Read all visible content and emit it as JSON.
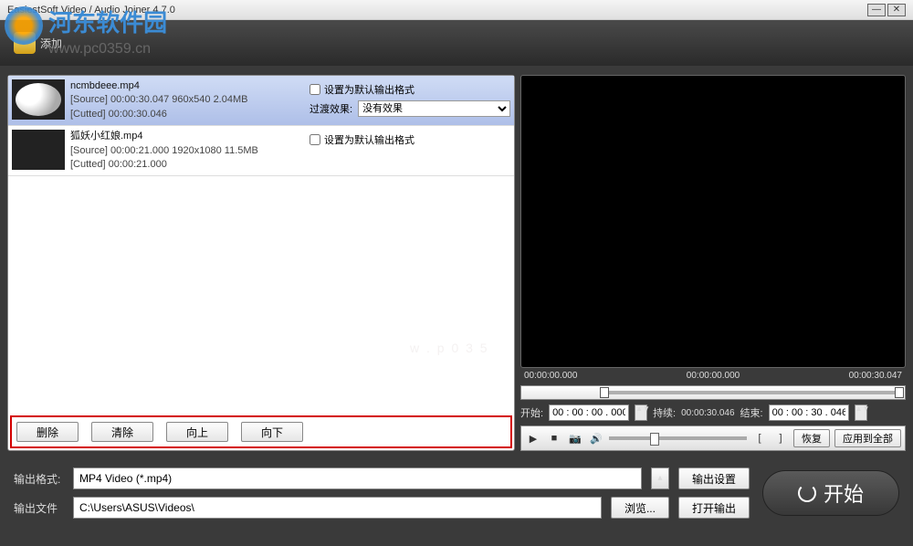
{
  "window": {
    "title": "EasiestSoft Video / Audio Joiner 4.7.0"
  },
  "watermark": {
    "text": "河东软件园",
    "url": "www.pc0359.cn"
  },
  "toolbar": {
    "add": "添加"
  },
  "items": [
    {
      "name": "ncmbdeee.mp4",
      "source": "[Source]  00:00:30.047  960x540  2.04MB",
      "cutted": "[Cutted]  00:00:30.046",
      "default_label": "设置为默认输出格式",
      "transition_label": "过渡效果:",
      "transition_value": "没有效果"
    },
    {
      "name": "狐妖小红娘.mp4",
      "source": "[Source]  00:00:21.000  1920x1080  11.5MB",
      "cutted": "[Cutted]  00:00:21.000",
      "default_label": "设置为默认输出格式"
    }
  ],
  "list_buttons": {
    "delete": "删除",
    "clear": "清除",
    "up": "向上",
    "down": "向下"
  },
  "preview": {
    "t0": "00:00:00.000",
    "t1": "00:00:00.000",
    "t2": "00:00:30.047",
    "start_label": "开始:",
    "start_val": "00 : 00 : 00 . 000",
    "dur_label": "持续:",
    "dur_val": "00:00:30.046",
    "end_label": "结束:",
    "end_val": "00 : 00 : 30 . 046",
    "restore": "恢复",
    "apply_all": "应用到全部"
  },
  "output": {
    "format_label": "输出格式:",
    "format_value": "MP4 Video (*.mp4)",
    "settings": "输出设置",
    "file_label": "输出文件",
    "file_value": "C:\\Users\\ASUS\\Videos\\",
    "browse": "浏览...",
    "open": "打开输出"
  },
  "start": "开始"
}
